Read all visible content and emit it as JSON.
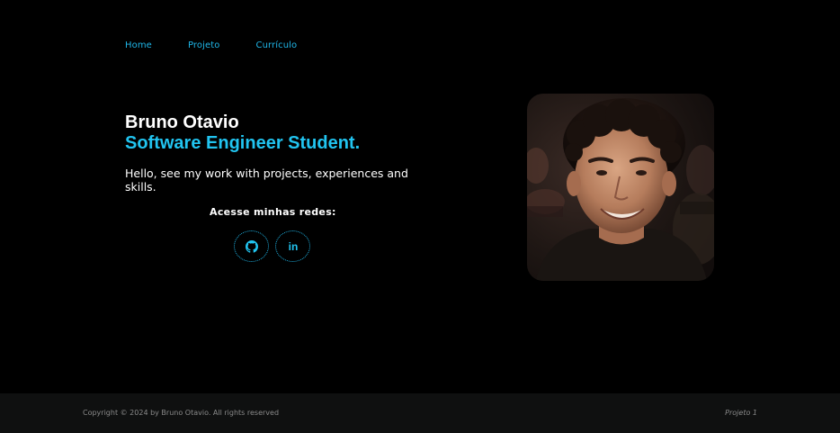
{
  "nav": {
    "items": [
      {
        "label": "Home"
      },
      {
        "label": "Projeto"
      },
      {
        "label": "Currículo"
      }
    ]
  },
  "hero": {
    "name": "Bruno Otavio",
    "role": "Software Engineer Student.",
    "description": "Hello, see my work with projects, experiences and skills.",
    "social_title": "Acesse minhas redes:",
    "social_links": [
      {
        "icon": "github-icon"
      },
      {
        "icon": "linkedin-icon",
        "glyph": "in"
      }
    ],
    "photo": {
      "subject": "portrait-photo"
    }
  },
  "footer": {
    "copyright": "Copyright © 2024 by Bruno Otavio. All rights reserved",
    "project": "Projeto 1"
  },
  "colors": {
    "background": "#000000",
    "accent": "#21c4f0",
    "footer_bg": "#0f1010",
    "footer_text": "#8a8a8a"
  }
}
